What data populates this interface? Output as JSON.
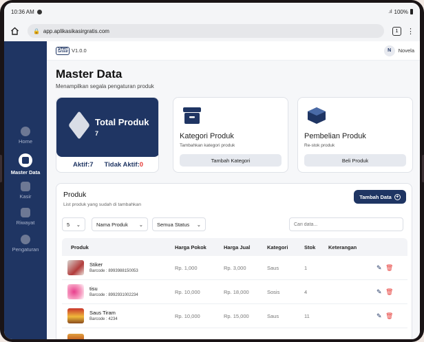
{
  "status_bar": {
    "time": "10:36 AM",
    "battery": "100%"
  },
  "browser": {
    "url": "app.aplikasikasirgratis.com",
    "tab_count": "1"
  },
  "sidebar": {
    "items": [
      {
        "label": "Home"
      },
      {
        "label": "Master Data"
      },
      {
        "label": "Kasir"
      },
      {
        "label": "Riwayat"
      },
      {
        "label": "Pengaturan"
      }
    ]
  },
  "topbar": {
    "logo_line1": "Smart",
    "logo_line2": "Grosir",
    "version": "V1.0.0",
    "user_initial": "N",
    "user_name": "Novela"
  },
  "page": {
    "title": "Master Data",
    "subtitle": "Menampilkan segala pengaturan produk"
  },
  "total_card": {
    "label": "Total Produk",
    "value": "7",
    "active_label": "Aktif:",
    "active_value": "7",
    "inactive_label": "Tidak Aktif:",
    "inactive_value": "0"
  },
  "kategori_card": {
    "title": "Kategori Produk",
    "subtitle": "Tambahkan kategori produk",
    "button": "Tambah Kategori"
  },
  "pembelian_card": {
    "title": "Pembelian Produk",
    "subtitle": "Re-stok produk",
    "button": "Beli Produk"
  },
  "produk_panel": {
    "title": "Produk",
    "subtitle": "List produk yang sudah di tambahkan",
    "add_button": "Tambah Data",
    "page_size": "5",
    "sort_select": "Nama Produk",
    "status_select": "Semua Status",
    "search_placeholder": "Cari data..."
  },
  "table": {
    "headers": [
      "Produk",
      "Harga Pokok",
      "Harga Jual",
      "Kategori",
      "Stok",
      "Keterangan"
    ],
    "rows": [
      {
        "name": "Stiker",
        "barcode": "Barcode : 8993988150053",
        "harga_pokok": "Rp. 1,000",
        "harga_jual": "Rp. 3,000",
        "kategori": "Saus",
        "stok": "1",
        "keterangan": ""
      },
      {
        "name": "tisu",
        "barcode": "Barcode : 8992931002234",
        "harga_pokok": "Rp. 10,000",
        "harga_jual": "Rp. 18,000",
        "kategori": "Sosis",
        "stok": "4",
        "keterangan": ""
      },
      {
        "name": "Saus Tiram",
        "barcode": "Barcode : 4234",
        "harga_pokok": "Rp. 10,000",
        "harga_jual": "Rp. 15,000",
        "kategori": "Saus",
        "stok": "11",
        "keterangan": ""
      }
    ]
  },
  "colors": {
    "primary": "#1f3563",
    "danger": "#e53935",
    "background": "#f6f7f9"
  }
}
